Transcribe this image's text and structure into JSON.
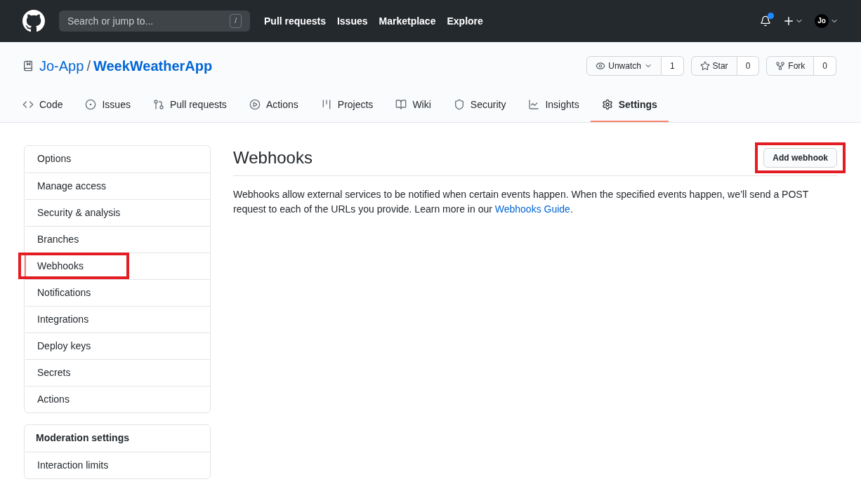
{
  "header": {
    "search_placeholder": "Search or jump to...",
    "search_key": "/",
    "nav": [
      "Pull requests",
      "Issues",
      "Marketplace",
      "Explore"
    ],
    "notification_unread": true,
    "avatar_initials": "Jo"
  },
  "repo": {
    "owner": "Jo-App",
    "separator": "/",
    "name": "WeekWeatherApp",
    "actions": [
      {
        "kind": "watch",
        "label": "Unwatch",
        "count": "1"
      },
      {
        "kind": "star",
        "label": "Star",
        "count": "0"
      },
      {
        "kind": "fork",
        "label": "Fork",
        "count": "0"
      }
    ]
  },
  "tabs": [
    {
      "kind": "code",
      "label": "Code",
      "selected": false
    },
    {
      "kind": "issues",
      "label": "Issues",
      "selected": false
    },
    {
      "kind": "pulls",
      "label": "Pull requests",
      "selected": false
    },
    {
      "kind": "actions",
      "label": "Actions",
      "selected": false
    },
    {
      "kind": "projects",
      "label": "Projects",
      "selected": false
    },
    {
      "kind": "wiki",
      "label": "Wiki",
      "selected": false
    },
    {
      "kind": "security",
      "label": "Security",
      "selected": false
    },
    {
      "kind": "insights",
      "label": "Insights",
      "selected": false
    },
    {
      "kind": "settings",
      "label": "Settings",
      "selected": true
    }
  ],
  "sidebar": {
    "items": [
      {
        "label": "Options",
        "selected": false,
        "annotated": false
      },
      {
        "label": "Manage access",
        "selected": false,
        "annotated": false
      },
      {
        "label": "Security & analysis",
        "selected": false,
        "annotated": false
      },
      {
        "label": "Branches",
        "selected": false,
        "annotated": false
      },
      {
        "label": "Webhooks",
        "selected": true,
        "annotated": true
      },
      {
        "label": "Notifications",
        "selected": false,
        "annotated": false
      },
      {
        "label": "Integrations",
        "selected": false,
        "annotated": false
      },
      {
        "label": "Deploy keys",
        "selected": false,
        "annotated": false
      },
      {
        "label": "Secrets",
        "selected": false,
        "annotated": false
      },
      {
        "label": "Actions",
        "selected": false,
        "annotated": false
      }
    ],
    "moderation": {
      "title": "Moderation settings",
      "items": [
        {
          "label": "Interaction limits",
          "selected": false
        }
      ]
    }
  },
  "main": {
    "title": "Webhooks",
    "button": {
      "label": "Add webhook",
      "annotated": true
    },
    "description": "Webhooks allow external services to be notified when certain events happen. When the specified events happen, we’ll send a POST request to each of the URLs you provide. Learn more in our ",
    "link": "Webhooks Guide",
    "description_end": "."
  }
}
